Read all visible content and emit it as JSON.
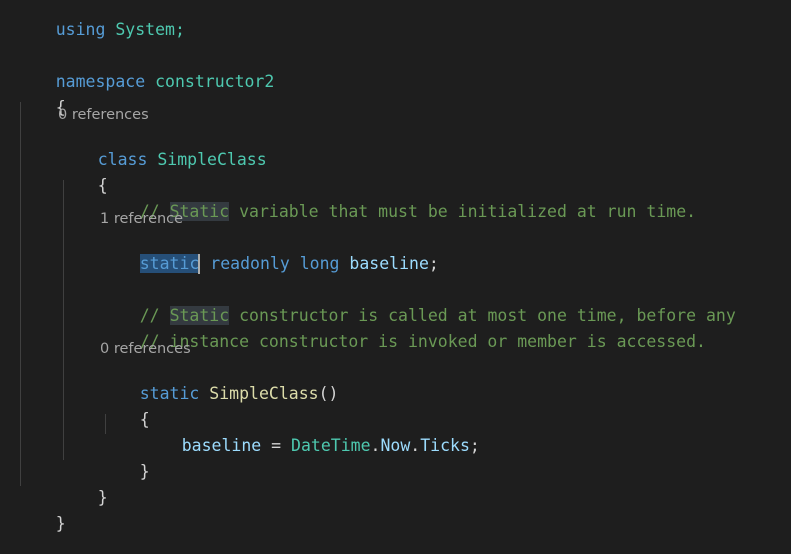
{
  "code": {
    "using_kw": "using",
    "using_target": "System;",
    "namespace_kw": "namespace",
    "namespace_name": "constructor2",
    "open_brace": "{",
    "close_brace": "}",
    "class_lens": "0 references",
    "class_kw": "class",
    "class_name": "SimpleClass",
    "comment1_prefix": "// ",
    "comment1_hl": "Static",
    "comment1_rest": " variable that must be initialized at run time.",
    "field_lens": "1 reference",
    "field_static": "static",
    "field_readonly": "readonly",
    "field_long": "long",
    "field_name": "baseline",
    "field_semicolon": ";",
    "comment2_prefix": "// ",
    "comment2_hl": "Static",
    "comment2_rest": " constructor is called at most one time, before any",
    "comment3": "// instance constructor is invoked or member is accessed.",
    "ctor_lens": "0 references",
    "ctor_static": "static",
    "ctor_name": "SimpleClass",
    "ctor_parens": "()",
    "assign_target": "baseline",
    "assign_op": " = ",
    "assign_type": "DateTime",
    "assign_dot1": ".",
    "assign_now": "Now",
    "assign_dot2": ".",
    "assign_ticks": "Ticks",
    "assign_semicolon": ";"
  }
}
